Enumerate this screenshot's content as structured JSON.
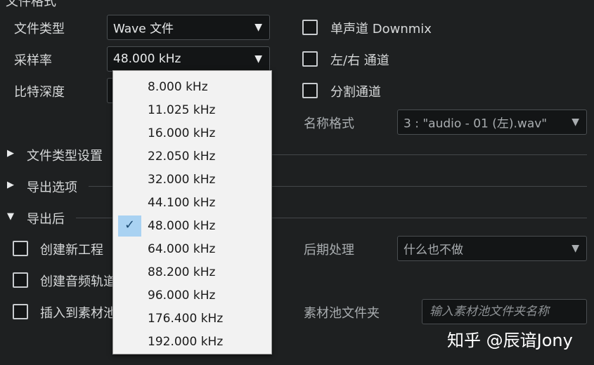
{
  "format": {
    "file_type_label": "文件类型",
    "file_type_value": "Wave 文件",
    "sample_rate_label": "采样率",
    "sample_rate_value": "48.000 kHz",
    "bit_depth_label": "比特深度",
    "mono_downmix_label": "单声道 Downmix",
    "lr_channels_label": "左/右 通道",
    "split_channels_label": "分割通道",
    "name_format_label": "名称格式",
    "name_format_value": "3 : \"audio - 01 (左).wav\""
  },
  "sections": {
    "file_type_settings": "文件类型设置",
    "export_options": "导出选项",
    "after_export": "导出后"
  },
  "after_export": {
    "create_project_label": "创建新工程",
    "create_audio_track_label": "创建音频轨道",
    "insert_pool_label": "插入到素材池",
    "post_process_label": "后期处理",
    "post_process_value": "什么也不做",
    "pool_folder_label": "素材池文件夹",
    "pool_folder_placeholder": "输入素材池文件夹名称"
  },
  "sample_rate_options": [
    "8.000 kHz",
    "11.025 kHz",
    "16.000 kHz",
    "22.050 kHz",
    "32.000 kHz",
    "44.100 kHz",
    "48.000 kHz",
    "64.000 kHz",
    "88.200 kHz",
    "96.000 kHz",
    "176.400 kHz",
    "192.000 kHz"
  ],
  "selected_option_index": 6,
  "watermark": "知乎 @辰谙Jony",
  "icons": {
    "dropdown_arrow": "▼",
    "expanded": "▼",
    "collapsed": "▶",
    "check": "✓"
  }
}
